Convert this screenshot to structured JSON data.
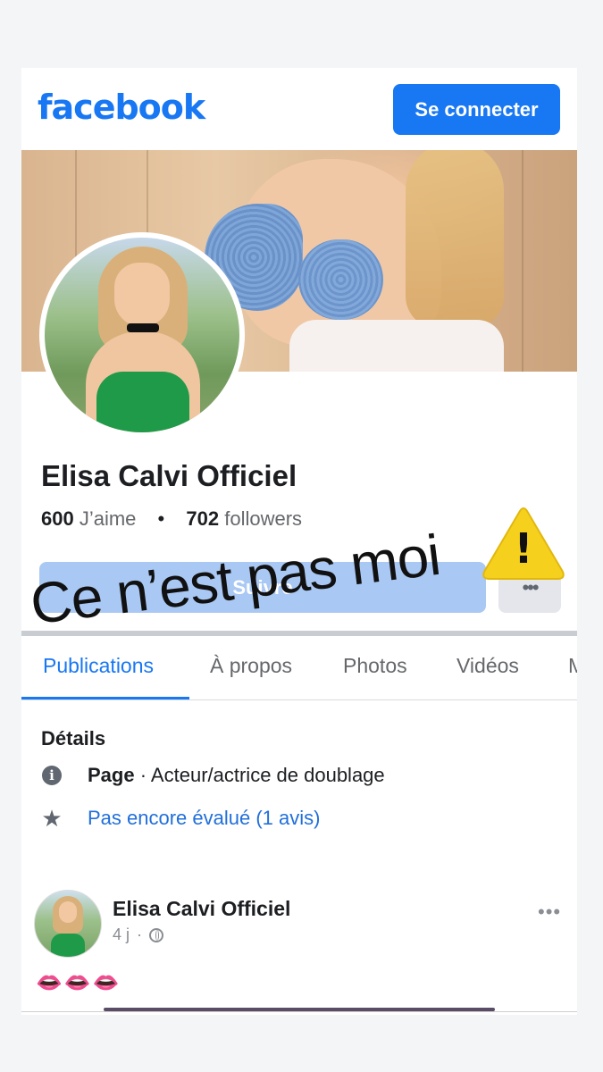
{
  "header": {
    "logo": "facebook",
    "login_label": "Se connecter"
  },
  "profile": {
    "name": "Elisa Calvi Officiel",
    "likes_count": "600",
    "likes_label": "J’aime",
    "followers_count": "702",
    "followers_label": "followers",
    "follow_label": "Suivre",
    "more_label": "•••"
  },
  "tabs": [
    "Publications",
    "À propos",
    "Photos",
    "Vidéos",
    "M"
  ],
  "details": {
    "title": "Détails",
    "category_label": "Page",
    "category_value": " · Acteur/actrice de doublage",
    "rating": "Pas encore évalué (1 avis)"
  },
  "post": {
    "author": "Elisa Calvi Officiel",
    "time": "4 j",
    "separator": "·",
    "more": "•••",
    "text": "👄👄👄"
  },
  "overlay": {
    "text": "Ce n’est pas moi",
    "warning_mark": "!"
  },
  "colors": {
    "brand": "#1877f2",
    "follow_disabled": "#a9c8f3",
    "warning": "#f5d11e"
  },
  "icons": {
    "info": "info-icon",
    "star": "star-icon",
    "globe": "globe-icon"
  }
}
